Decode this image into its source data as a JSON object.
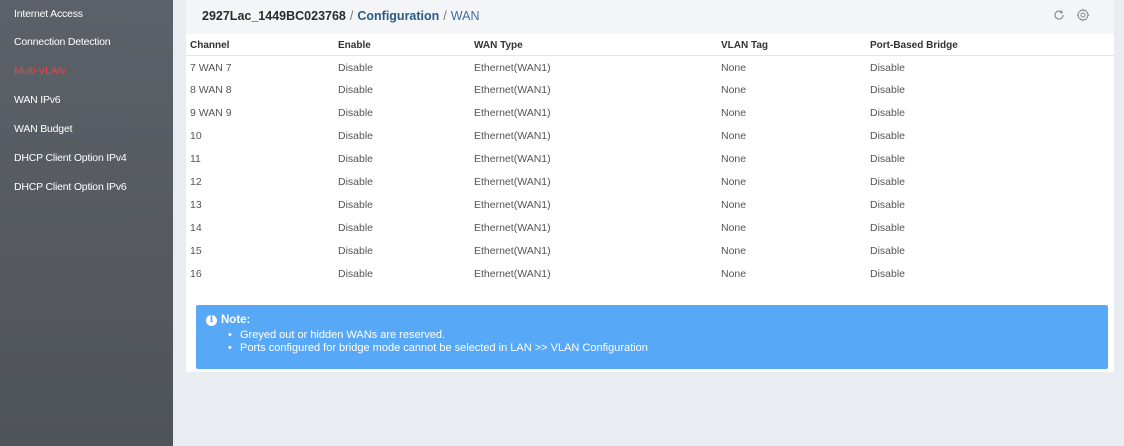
{
  "sidebar": {
    "items": [
      {
        "label": "Internet Access"
      },
      {
        "label": "Connection Detection"
      },
      {
        "label": "Multi-VLAN"
      },
      {
        "label": "WAN IPv6"
      },
      {
        "label": "WAN Budget"
      },
      {
        "label": "DHCP Client Option IPv4"
      },
      {
        "label": "DHCP Client Option IPv6"
      }
    ],
    "active_color": "#ff3b3b"
  },
  "header": {
    "device": "2927Lac_1449BC023768",
    "separator": "/",
    "section": "Configuration",
    "page": "WAN",
    "refresh_icon": "refresh-icon",
    "settings_icon": "gear-icon"
  },
  "table": {
    "columns": [
      "Channel",
      "Enable",
      "WAN Type",
      "VLAN Tag",
      "Port-Based Bridge"
    ],
    "rows": [
      [
        "7  WAN 7",
        "Disable",
        "Ethernet(WAN1)",
        "None",
        "Disable"
      ],
      [
        "8  WAN 8",
        "Disable",
        "Ethernet(WAN1)",
        "None",
        "Disable"
      ],
      [
        "9  WAN 9",
        "Disable",
        "Ethernet(WAN1)",
        "None",
        "Disable"
      ],
      [
        "10",
        "Disable",
        "Ethernet(WAN1)",
        "None",
        "Disable"
      ],
      [
        "11",
        "Disable",
        "Ethernet(WAN1)",
        "None",
        "Disable"
      ],
      [
        "12",
        "Disable",
        "Ethernet(WAN1)",
        "None",
        "Disable"
      ],
      [
        "13",
        "Disable",
        "Ethernet(WAN1)",
        "None",
        "Disable"
      ],
      [
        "14",
        "Disable",
        "Ethernet(WAN1)",
        "None",
        "Disable"
      ],
      [
        "15",
        "Disable",
        "Ethernet(WAN1)",
        "None",
        "Disable"
      ],
      [
        "16",
        "Disable",
        "Ethernet(WAN1)",
        "None",
        "Disable"
      ]
    ]
  },
  "note": {
    "title": "Note:",
    "items": [
      "Greyed out or hidden WANs are reserved.",
      "Ports configured for bridge mode cannot be selected in LAN >> VLAN Configuration"
    ],
    "background_color": "#58a8f8"
  }
}
